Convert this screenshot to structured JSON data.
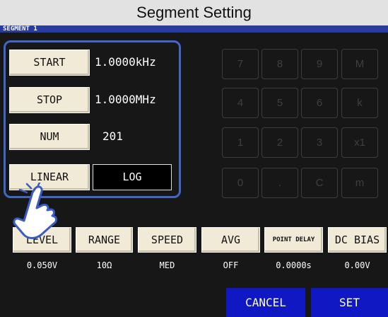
{
  "title": "Segment Setting",
  "segment_label": "SEGMENT 1",
  "sweep": {
    "start_label": "START",
    "start_value": "1.0000kHz",
    "stop_label": "STOP",
    "stop_value": "1.0000MHz",
    "num_label": "NUM",
    "num_value": "201",
    "linear_label": "LINEAR",
    "log_label": "LOG"
  },
  "keypad": {
    "keys": [
      "7",
      "8",
      "9",
      "M",
      "4",
      "5",
      "6",
      "k",
      "1",
      "2",
      "3",
      "x1",
      "0",
      ".",
      "C",
      "m"
    ]
  },
  "params": [
    {
      "label": "LEVEL",
      "value": "0.050V"
    },
    {
      "label": "RANGE",
      "value": "10Ω"
    },
    {
      "label": "SPEED",
      "value": "MED"
    },
    {
      "label": "AVG",
      "value": "OFF"
    },
    {
      "label": "POINT DELAY",
      "value": "0.0000s"
    },
    {
      "label": "DC BIAS",
      "value": "0.00V"
    }
  ],
  "footer": {
    "cancel_label": "CANCEL",
    "set_label": "SET"
  },
  "colors": {
    "highlight": "#4166c8",
    "selected_bg": "#000000",
    "action_blue": "#1018c4"
  },
  "icons": {
    "pointer": "tap-hand-icon"
  }
}
